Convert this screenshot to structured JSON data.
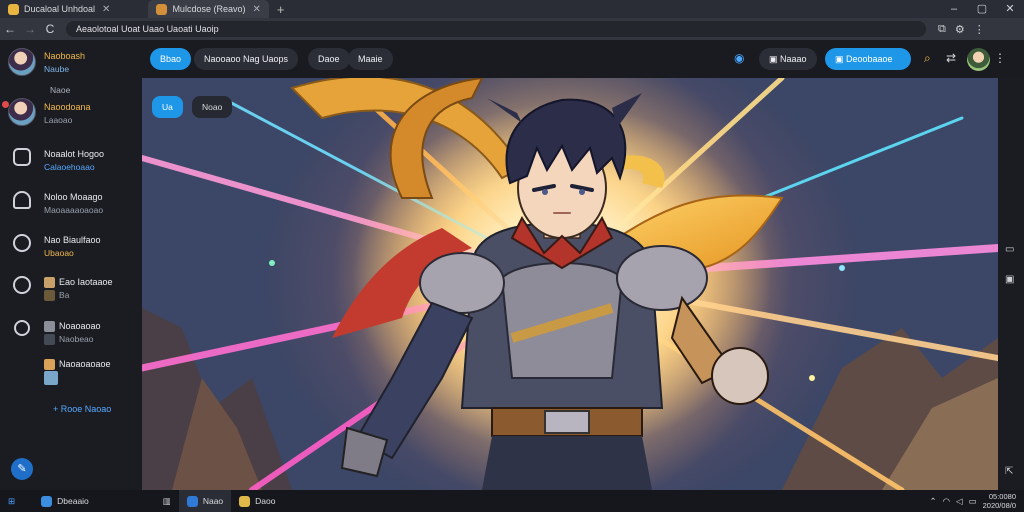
{
  "browser": {
    "tabs": [
      {
        "label": "Ducaloal Unhdoal",
        "active": false,
        "favicon_color": "#e8b640"
      },
      {
        "label": "Mulcdose (Reavo)",
        "active": true,
        "favicon_color": "#d48f3a"
      }
    ],
    "new_tab": "+",
    "window_controls": {
      "minimize": "–",
      "maximize": "▢",
      "close": "✕"
    },
    "nav": {
      "back": "←",
      "forward": "→",
      "reload": "C"
    },
    "url": "Aeaolotoal Uoat Uaao Uaoati Uaoip"
  },
  "sidebar": {
    "user": {
      "name": "Naoboash",
      "subtitle": "Naube"
    },
    "section": "Naoe",
    "items": [
      {
        "title": "Naoodoana",
        "sub": "Laaoao",
        "icon": "avatar",
        "badge": true
      },
      {
        "title": "Noaalot Hogoo",
        "sub": "Calaoehoaao",
        "icon": "shopping-bag-icon"
      },
      {
        "title": "Noloo Moaago",
        "sub": "Maoaaaaoaoao",
        "icon": "bell-icon"
      },
      {
        "title": "Nao Biaulfaoo",
        "sub": "Ubaoao",
        "icon": "info-icon"
      },
      {
        "title": "Eao Iaotaaoe",
        "sub": "Ba",
        "icon": "clock-icon"
      },
      {
        "title": "Noaoaoao",
        "sub": "Naobeao",
        "icon": "settings-icon"
      },
      {
        "title": "Naoaoaoaoe",
        "sub": "",
        "icon": "image-icon"
      }
    ],
    "add_label": "+ Rooe Naoao",
    "bottom_icon": "help-icon"
  },
  "toolbar": {
    "btn_primary": "Bbao",
    "btn_title": "Naooaoo Nag Uaops",
    "btn_mode": "Daoe",
    "btn_more": "Maaie",
    "btn_share": "Naaao",
    "btn_download": "Deoobaaoe"
  },
  "stage": {
    "chip_active": "Ua",
    "chip_secondary": "Noao"
  },
  "taskbar": {
    "start": "⊞",
    "app1": "Dbeaaio",
    "app2": "Naao",
    "app3": "Daoo",
    "time": "05:0080",
    "date": "2020/08/0"
  },
  "colors": {
    "accent": "#1f97e8",
    "gold": "#f2b84b",
    "background": "#1b1d24"
  }
}
